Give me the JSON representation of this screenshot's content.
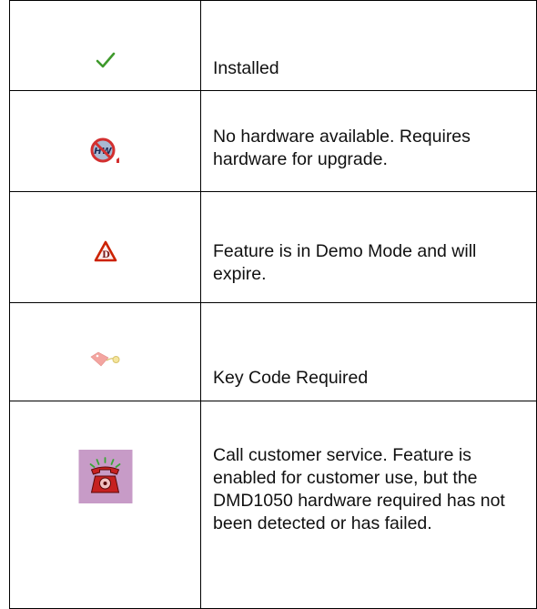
{
  "rows": [
    {
      "icon": "checkmark-icon",
      "description": "Installed"
    },
    {
      "icon": "no-hardware-icon",
      "description": "No hardware available. Requires hardware for upgrade."
    },
    {
      "icon": "demo-warning-icon",
      "description": "Feature is in Demo Mode and will expire."
    },
    {
      "icon": "key-tag-icon",
      "description": "Key Code Required"
    },
    {
      "icon": "ringing-phone-icon",
      "description": "Call customer service. Feature is enabled for customer use, but the DMD1050 hardware required has not been detected or has failed."
    }
  ],
  "colors": {
    "border": "#000000",
    "check": "#3f9a2c",
    "no_hw_red": "#d32f2f",
    "demo_red": "#cc2200",
    "key_tag": "#f3a5a0",
    "phone_bg": "#c79bc7",
    "phone_red": "#c62020"
  }
}
